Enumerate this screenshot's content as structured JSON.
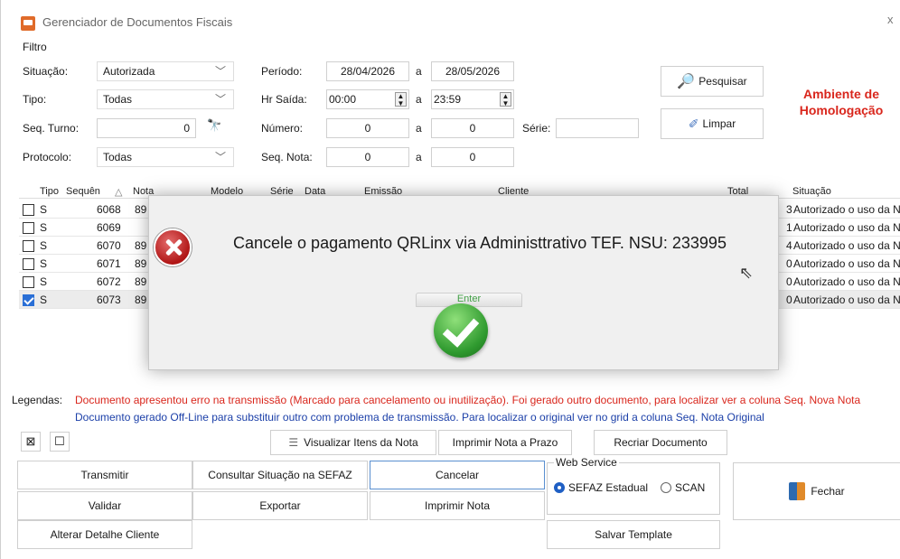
{
  "window": {
    "title": "Gerenciador de Documentos Fiscais",
    "close_glyph": "x"
  },
  "filter": {
    "group_label": "Filtro",
    "situacao_label": "Situação:",
    "situacao_value": "Autorizada",
    "tipo_label": "Tipo:",
    "tipo_value": "Todas",
    "seq_turno_label": "Seq. Turno:",
    "seq_turno_value": "0",
    "protocolo_label": "Protocolo:",
    "protocolo_value": "Todas",
    "periodo_label": "Período:",
    "periodo_from": "28/04/2026",
    "periodo_sep": "a",
    "periodo_to": "28/05/2026",
    "hr_saida_label": "Hr Saída:",
    "hr_from": "00:00",
    "hr_sep": "a",
    "hr_to": "23:59",
    "numero_label": "Número:",
    "numero_from": "0",
    "numero_sep": "a",
    "numero_to": "0",
    "serie_label": "Série:",
    "serie_value": "",
    "seq_nota_label": "Seq. Nota:",
    "seq_nota_from": "0",
    "seq_nota_sep": "a",
    "seq_nota_to": "0",
    "pesquisar_label": "Pesquisar",
    "limpar_label": "Limpar",
    "ambiente_line1": "Ambiente de",
    "ambiente_line2": "Homologação"
  },
  "grid": {
    "headers": {
      "tipo": "Tipo",
      "sequencia": "Sequên",
      "sort_glyph": "△",
      "nota": "Nota",
      "modelo": "Modelo",
      "serie": "Série",
      "data": "Data",
      "emissao": "Emissão",
      "cliente": "Cliente",
      "total": "Total",
      "situacao": "Situação"
    },
    "rows": [
      {
        "tipo": "S",
        "seq": "6068",
        "nota": "89",
        "total": "3",
        "situacao": "Autorizado o uso da N",
        "checked": false
      },
      {
        "tipo": "S",
        "seq": "6069",
        "nota": "",
        "total": "1",
        "situacao": "Autorizado o uso da N",
        "checked": false
      },
      {
        "tipo": "S",
        "seq": "6070",
        "nota": "89",
        "total": "4",
        "situacao": "Autorizado o uso da N",
        "checked": false
      },
      {
        "tipo": "S",
        "seq": "6071",
        "nota": "89",
        "total": "0",
        "situacao": "Autorizado o uso da N",
        "checked": false
      },
      {
        "tipo": "S",
        "seq": "6072",
        "nota": "89",
        "total": "0",
        "situacao": "Autorizado o uso da N",
        "checked": false
      },
      {
        "tipo": "S",
        "seq": "6073",
        "nota": "89",
        "total": "0",
        "situacao": "Autorizado o uso da N",
        "checked": true
      }
    ]
  },
  "dialog": {
    "message": "Cancele o pagamento QRLinx via Administtrativo TEF. NSU: 233995",
    "enter_label": "Enter"
  },
  "legend": {
    "label": "Legendas:",
    "line1": "Documento apresentou erro na transmissão (Marcado para cancelamento ou inutilização). Foi gerado outro documento, para localizar ver a coluna Seq. Nova Nota",
    "line2": "Documento gerado Off-Line para substituir outro com problema  de transmissão. Para localizar o original ver no grid a coluna Seq. Nota Original"
  },
  "toolbar": {
    "check_all_glyph": "⊠",
    "uncheck_all_glyph": "☐",
    "visualizar_label": "Visualizar Itens da Nota",
    "imprimir_prazo_label": "Imprimir Nota a Prazo",
    "recriar_label": "Recriar Documento"
  },
  "actions": {
    "transmitir": "Transmitir",
    "consultar": "Consultar Situação na SEFAZ",
    "cancelar": "Cancelar",
    "validar": "Validar",
    "exportar": "Exportar",
    "imprimir_nota": "Imprimir Nota",
    "alterar_cliente": "Alterar Detalhe Cliente",
    "salvar_template": "Salvar Template",
    "fechar": "Fechar"
  },
  "webservice": {
    "label": "Web Service",
    "opt1": "SEFAZ Estadual",
    "opt2": "SCAN",
    "selected": "SEFAZ Estadual"
  },
  "colors": {
    "accent": "#1f5fc4",
    "error_text": "#d9261c",
    "info_text": "#1b3fa8",
    "ok_green": "#2f9a2f"
  }
}
